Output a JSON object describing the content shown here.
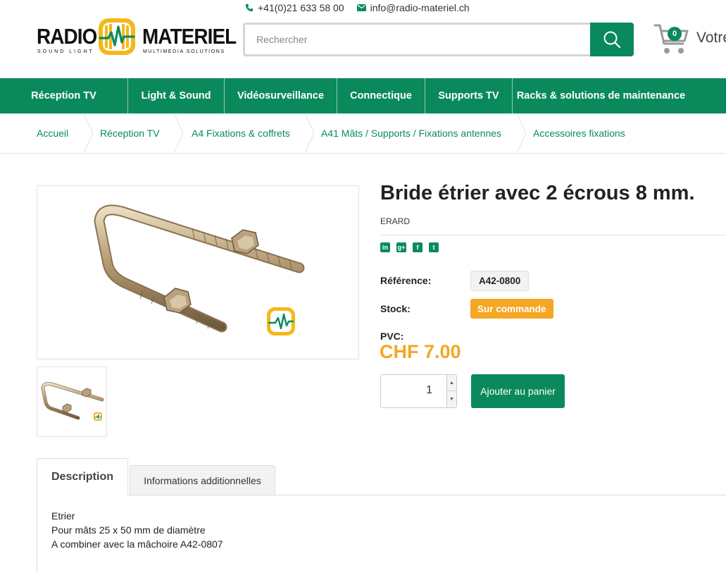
{
  "contact": {
    "phone": "+41(0)21 633 58 00",
    "email": "info@radio-materiel.ch"
  },
  "logo": {
    "left_word": "RADIO",
    "right_word": "MATERIEL",
    "left_tagline": "SOUND LIGHT",
    "right_tagline": "MULTIMEDIA SOLUTIONS"
  },
  "search": {
    "placeholder": "Rechercher"
  },
  "cart": {
    "count": "0",
    "label": "Votre"
  },
  "nav": [
    "Réception TV",
    "Light & Sound",
    "Vidéosurveillance",
    "Connectique",
    "Supports TV",
    "Racks & solutions de maintenance"
  ],
  "breadcrumb": [
    "Accueil",
    "Réception TV",
    "A4 Fixations & coffrets",
    "A41 Mâts / Supports / Fixations antennes",
    "Accessoires fixations"
  ],
  "product": {
    "title": "Bride étrier avec 2 écrous 8 mm.",
    "brand": "ERARD",
    "reference_label": "Référence:",
    "reference": "A42-0800",
    "stock_label": "Stock:",
    "stock": "Sur commande",
    "price_label": "PVC:",
    "price": "CHF 7.00",
    "quantity": "1",
    "add_to_cart": "Ajouter au panier"
  },
  "social_icons": [
    "linkedin-icon",
    "google-plus-icon",
    "facebook-icon",
    "twitter-icon"
  ],
  "tabs": {
    "description": "Description",
    "additional": "Informations additionnelles"
  },
  "description": {
    "line1": "Etrier",
    "line2": "Pour mâts 25 x 50 mm de diamètre",
    "line3": "A combiner avec la mâchoire A42-0807"
  },
  "colors": {
    "brand_green": "#0a8a5c",
    "accent_orange": "#f5a623"
  }
}
